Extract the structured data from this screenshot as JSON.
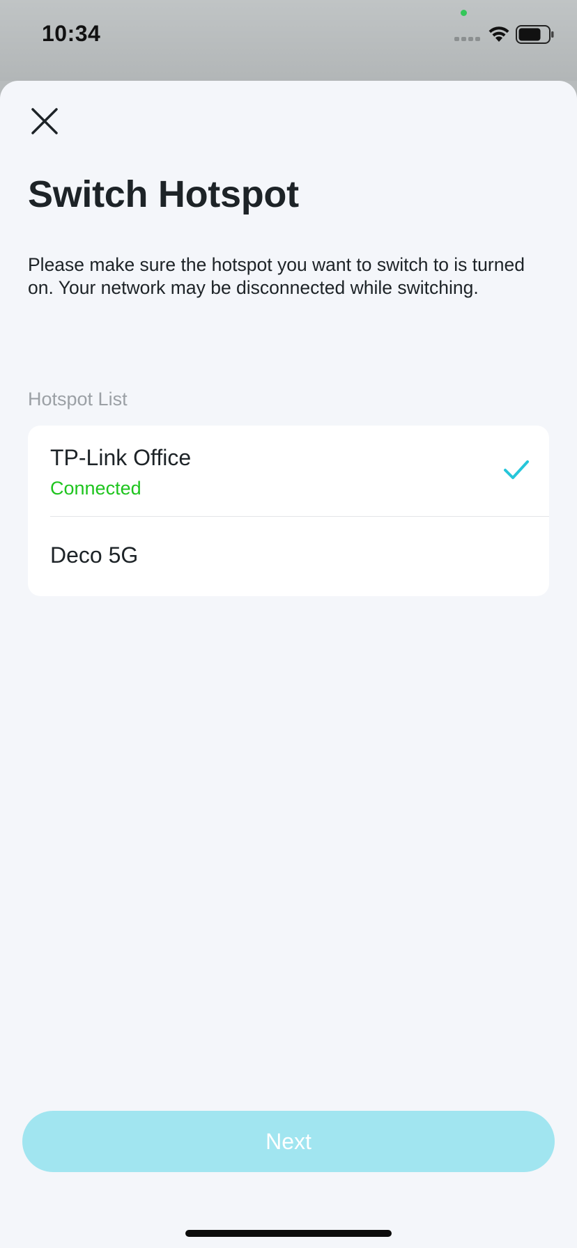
{
  "status_bar": {
    "time": "10:34",
    "icons": [
      "cellular-signal-icon",
      "wifi-icon",
      "battery-icon"
    ]
  },
  "header": {
    "close_icon": "close-icon",
    "title": "Switch Hotspot"
  },
  "main": {
    "description": "Please make sure the hotspot you want to switch to is turned on. Your network may be disconnected while switching.",
    "list_label": "Hotspot List",
    "hotspots": [
      {
        "name": "TP-Link Office",
        "status": "Connected",
        "selected": true
      },
      {
        "name": "Deco 5G",
        "status": "",
        "selected": false
      }
    ]
  },
  "footer": {
    "next_label": "Next"
  },
  "colors": {
    "accent": "#26c6da",
    "connected": "#1ec41e",
    "button_disabled": "#a1e5f0",
    "background": "#f4f6fa"
  }
}
